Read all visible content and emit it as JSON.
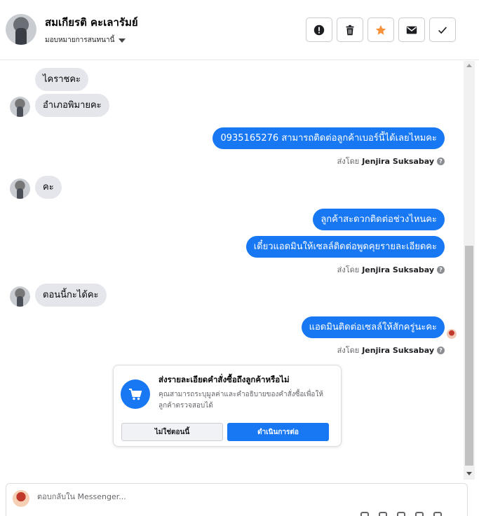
{
  "header": {
    "contact_name": "สมเกียรติ คะเลารัมย์",
    "assign_label": "มอบหมายการสนทนานี้",
    "actions": [
      {
        "name": "report-button",
        "icon": "alert-icon"
      },
      {
        "name": "delete-button",
        "icon": "trash-icon"
      },
      {
        "name": "star-button",
        "icon": "star-icon"
      },
      {
        "name": "mark-unread-button",
        "icon": "envelope-icon"
      },
      {
        "name": "mark-done-button",
        "icon": "check-icon"
      }
    ]
  },
  "messages": {
    "m1": "ไคราชคะ",
    "m2": "อำเภอพิมายคะ",
    "m3": "0935165276 สามารถติดต่อลูกค้าเบอร์นี้ได้เลยไหมคะ",
    "m4": "คะ",
    "m5": "ลูกค้าสะดวกติดต่อช่วงไหนคะ",
    "m6": "เดี๋ยวแอดมินให้เซลล์ติดต่อพูดคุยรายละเอียดคะ",
    "m7": "ตอนนี้กะได้คะ",
    "m8": "แอดมินติดต่อเซลล์ให้สักครู่นะคะ"
  },
  "sent_by": {
    "prefix": "ส่งโดย",
    "name": "Jenjira Suksabay",
    "help": "?"
  },
  "order_card": {
    "title": "ส่งรายละเอียดคำสั่งซื้อถึงลูกค้าหรือไม่",
    "description": "คุณสามารถระบุมูลค่าและคำอธิบายของคำสั่งซื้อเพื่อให้ลูกค้าตรวจสอบได้",
    "decline_label": "ไม่ใช่ตอนนี้",
    "confirm_label": "ดำเนินการต่อ"
  },
  "composer": {
    "placeholder": "ตอบกลับใน Messenger..."
  },
  "colors": {
    "accent": "#1877f2",
    "incoming_bubble": "#e4e6eb",
    "star": "#f7923a"
  }
}
